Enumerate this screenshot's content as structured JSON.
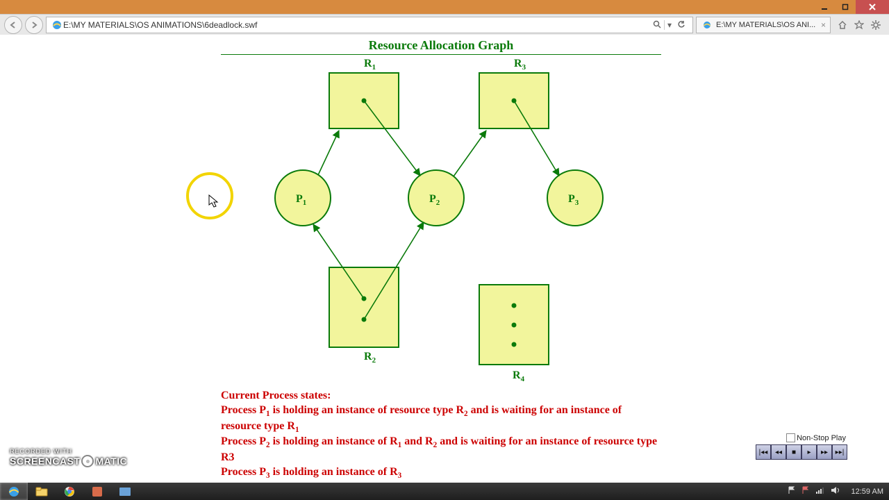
{
  "window": {
    "min_tooltip": "Minimize",
    "max_tooltip": "Restore",
    "close_tooltip": "Close"
  },
  "browser": {
    "url": "E:\\MY MATERIALS\\OS ANIMATIONS\\6deadlock.swf",
    "tab_title": "E:\\MY MATERIALS\\OS ANI...",
    "search_placeholder": "Search"
  },
  "diagram": {
    "title": "Resource Allocation Graph",
    "resources": {
      "R1": {
        "label": "R",
        "sub": "1",
        "instances": 1
      },
      "R2": {
        "label": "R",
        "sub": "2",
        "instances": 2
      },
      "R3": {
        "label": "R",
        "sub": "3",
        "instances": 1
      },
      "R4": {
        "label": "R",
        "sub": "4",
        "instances": 3
      }
    },
    "processes": {
      "P1": {
        "label": "P",
        "sub": "1"
      },
      "P2": {
        "label": "P",
        "sub": "2"
      },
      "P3": {
        "label": "P",
        "sub": "3"
      }
    },
    "edges": [
      {
        "from": "P1",
        "to": "R1",
        "type": "request"
      },
      {
        "from": "R1",
        "to": "P2",
        "type": "assignment"
      },
      {
        "from": "P2",
        "to": "R3",
        "type": "request"
      },
      {
        "from": "R3",
        "to": "P3",
        "type": "assignment"
      },
      {
        "from": "R2",
        "to": "P1",
        "type": "assignment"
      },
      {
        "from": "R2",
        "to": "P2",
        "type": "assignment"
      }
    ]
  },
  "state_text": {
    "heading": "Current Process states:",
    "line1a": "Process P",
    "line1a_sub": "1",
    "line1b": " is holding an instance of resource type R",
    "line1b_sub": "2",
    "line1c": " and is waiting for an instance of resource type R",
    "line1c_sub": "1",
    "line2a": "Process P",
    "line2a_sub": "2",
    "line2b": " is holding an instance of R",
    "line2b_sub": "1",
    "line2c": " and R",
    "line2c_sub": "2",
    "line2d": " and is waiting for an instance of resource type R3",
    "line3a": "Process P",
    "line3a_sub": "3",
    "line3b": " is holding an instance of R",
    "line3b_sub": "3"
  },
  "flash": {
    "nonstop_label": "Non-Stop Play"
  },
  "watermark": {
    "line1": "RECORDED WITH",
    "line2a": "SCREENCAST",
    "line2b": "MATIC"
  },
  "taskbar": {
    "time": "12:59 AM"
  }
}
